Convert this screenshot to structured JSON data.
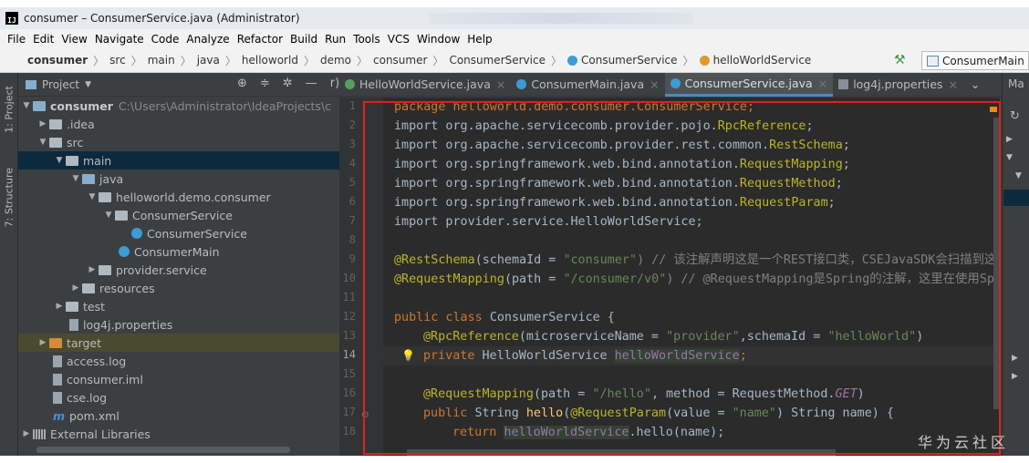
{
  "window": {
    "title": "consumer – ConsumerService.java (Administrator)",
    "app_icon": "IJ"
  },
  "menu": [
    "File",
    "Edit",
    "View",
    "Navigate",
    "Code",
    "Analyze",
    "Refactor",
    "Build",
    "Run",
    "Tools",
    "VCS",
    "Window",
    "Help"
  ],
  "breadcrumb": {
    "items": [
      "consumer",
      "src",
      "main",
      "java",
      "helloworld",
      "demo",
      "consumer",
      "ConsumerService",
      "ConsumerService",
      "helloWorldService"
    ],
    "run_config": "ConsumerMain"
  },
  "left_strip": {
    "project_tab": "1: Project",
    "structure_tab": "7: Structure"
  },
  "project_panel": {
    "title": "Project",
    "collapse_hint": "r)",
    "tree": [
      {
        "label": "consumer",
        "detail": "C:\\Users\\Administrator\\IdeaProjects\\c",
        "icon": "module-folder-icon",
        "arrow": "▼"
      },
      {
        "label": ".idea",
        "icon": "folder-icon",
        "arrow": "▶"
      },
      {
        "label": "src",
        "icon": "folder-icon",
        "arrow": "▼"
      },
      {
        "label": "main",
        "icon": "folder-icon",
        "arrow": "▼"
      },
      {
        "label": "java",
        "icon": "source-folder-icon",
        "arrow": "▼"
      },
      {
        "label": "helloworld.demo.consumer",
        "icon": "package-icon",
        "arrow": "▼"
      },
      {
        "label": "ConsumerService",
        "icon": "package-icon",
        "arrow": "▼"
      },
      {
        "label": "ConsumerService",
        "icon": "class-icon",
        "arrow": ""
      },
      {
        "label": "ConsumerMain",
        "icon": "class-main-icon",
        "arrow": ""
      },
      {
        "label": "provider.service",
        "icon": "package-icon",
        "arrow": "▶"
      },
      {
        "label": "resources",
        "icon": "resources-folder-icon",
        "arrow": "▶"
      },
      {
        "label": "test",
        "icon": "folder-icon",
        "arrow": "▶"
      },
      {
        "label": "log4j.properties",
        "icon": "properties-file-icon",
        "arrow": ""
      },
      {
        "label": "target",
        "icon": "excluded-folder-icon",
        "arrow": "▶"
      },
      {
        "label": "access.log",
        "icon": "log-file-icon",
        "arrow": ""
      },
      {
        "label": "consumer.iml",
        "icon": "iml-file-icon",
        "arrow": ""
      },
      {
        "label": "cse.log",
        "icon": "log-file-icon",
        "arrow": ""
      },
      {
        "label": "pom.xml",
        "icon": "maven-icon",
        "arrow": ""
      },
      {
        "label": "External Libraries",
        "icon": "libraries-icon",
        "arrow": "▶"
      }
    ]
  },
  "tabs": [
    {
      "label": "HelloWorldService.java",
      "color": "#56a05f",
      "active": false
    },
    {
      "label": "ConsumerMain.java",
      "color": "#3d9bd6",
      "active": false
    },
    {
      "label": "ConsumerService.java",
      "color": "#3d9bd6",
      "active": true
    },
    {
      "label": "log4j.properties",
      "color": "#8a8f96",
      "active": false
    }
  ],
  "tab_overflow": "Ma",
  "editor": {
    "line_numbers": [
      "1",
      "2",
      "3",
      "4",
      "5",
      "6",
      "7",
      "8",
      "9",
      "10",
      "11",
      "12",
      "13",
      "14",
      "15",
      "16",
      "17",
      "18"
    ],
    "current_line": "14",
    "code": {
      "l1": "package helloworld.demo.consumer.ConsumerService;",
      "l2a": "import org.apache.servicecomb.provider.pojo.",
      "l2b": "RpcReference",
      "l2c": ";",
      "l3a": "import org.apache.servicecomb.provider.rest.common.",
      "l3b": "RestSchema",
      "l3c": ";",
      "l4a": "import org.springframework.web.bind.annotation.",
      "l4b": "RequestMapping",
      "l4c": ";",
      "l5a": "import org.springframework.web.bind.annotation.",
      "l5b": "RequestMethod",
      "l5c": ";",
      "l6a": "import org.springframework.web.bind.annotation.",
      "l6b": "RequestParam",
      "l6c": ";",
      "l7a": "import provider.service.",
      "l7b": "HelloWorldService",
      "l7c": ";",
      "l9a": "@RestSchema",
      "l9b": "(schemaId = ",
      "l9c": "\"consumer\"",
      "l9d": ") // 该注解声明这是一个REST接口类，CSEJavaSDK会扫描到这个",
      "l10a": "@RequestMapping",
      "l10b": "(path = ",
      "l10c": "\"/consumer/v0\"",
      "l10d": ") // @RequestMapping是Spring的注解，这里在使用Spr",
      "l12a": "public class ",
      "l12b": "ConsumerService {",
      "l13a": "@RpcReference",
      "l13b": "(microserviceName = ",
      "l13c": "\"provider\"",
      "l13d": ",schemaId = ",
      "l13e": "\"helloWorld\"",
      "l13f": ")",
      "l14a": "private ",
      "l14b": "HelloWorldService ",
      "l14c": "helloWorldService",
      "l14d": ";",
      "l16a": "@RequestMapping",
      "l16b": "(path = ",
      "l16c": "\"/hello\"",
      "l16d": ", method = RequestMethod.",
      "l16e": "GET",
      "l16f": ")",
      "l17a": "public ",
      "l17b": "String ",
      "l17c": "hello",
      "l17d": "(",
      "l17e": "@RequestParam",
      "l17f": "(value = ",
      "l17g": "\"name\"",
      "l17h": ") String name) {",
      "l18a": "return ",
      "l18b": "helloWorldService",
      "l18c": ".hello(name);",
      "kw_import": "import"
    }
  },
  "watermark": "华为云社区"
}
